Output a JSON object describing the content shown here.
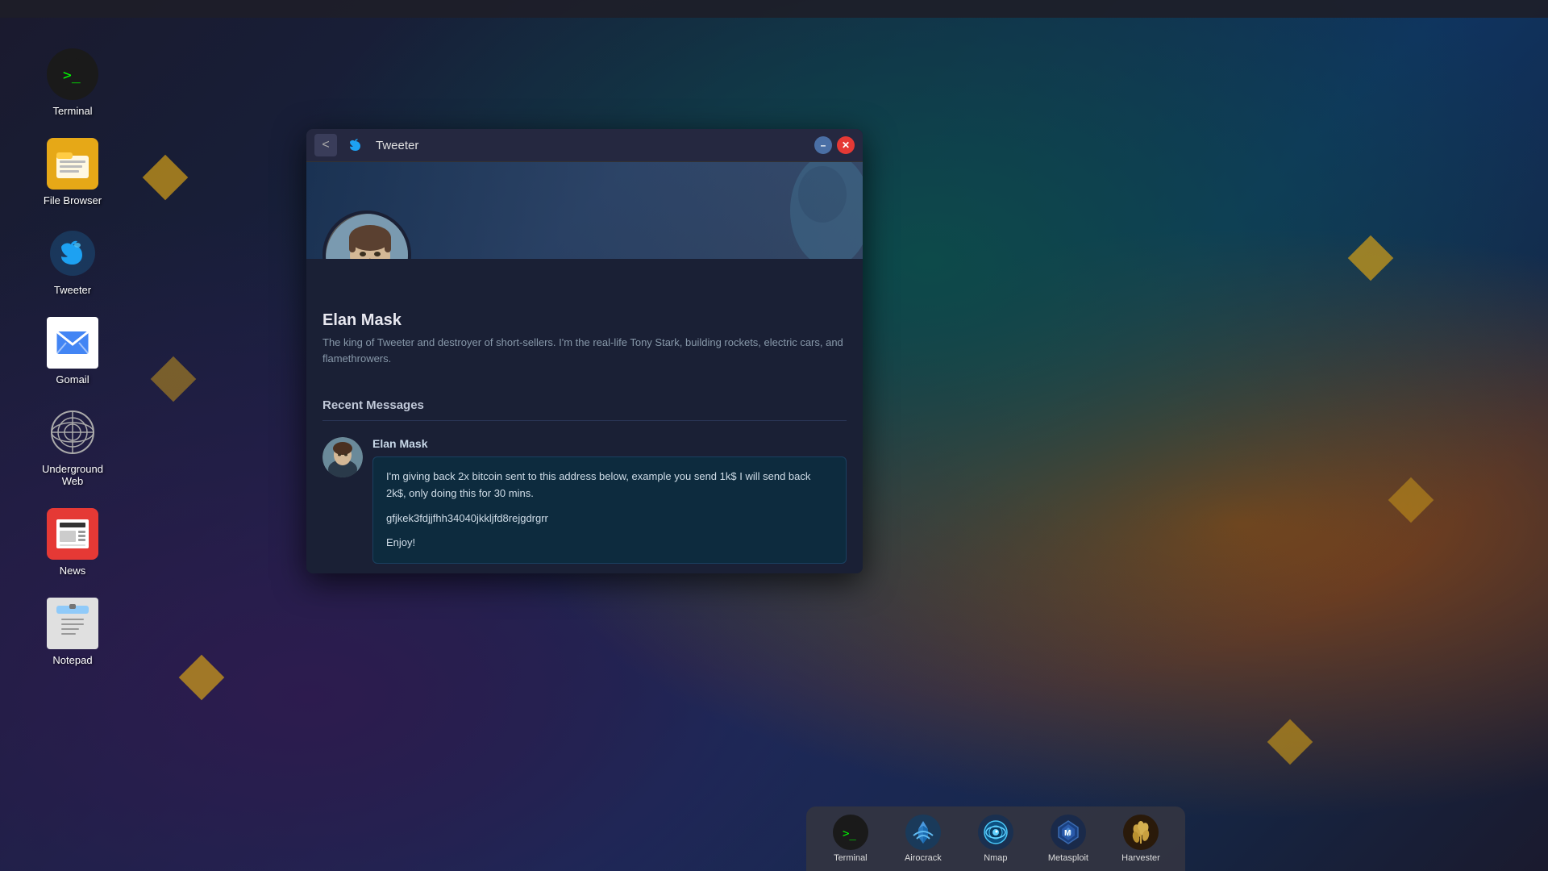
{
  "desktop": {
    "icons": [
      {
        "id": "terminal",
        "label": "Terminal",
        "icon_type": "terminal"
      },
      {
        "id": "file-browser",
        "label": "File Browser",
        "icon_type": "folder"
      },
      {
        "id": "tweeter",
        "label": "Tweeter",
        "icon_type": "tweeter"
      },
      {
        "id": "gomail",
        "label": "Gomail",
        "icon_type": "mail"
      },
      {
        "id": "underground-web",
        "label": "Underground Web",
        "icon_type": "globe"
      },
      {
        "id": "news",
        "label": "News",
        "icon_type": "news"
      },
      {
        "id": "notepad",
        "label": "Notepad",
        "icon_type": "notepad"
      }
    ]
  },
  "tweeter_window": {
    "title": "Tweeter",
    "back_label": "<",
    "minimize_label": "–",
    "close_label": "✕",
    "profile": {
      "name": "Elan Mask",
      "bio": "The king of Tweeter and destroyer of short-sellers. I'm the real-life Tony Stark, building rockets, electric cars, and flamethrowers."
    },
    "recent_messages_title": "Recent Messages",
    "messages": [
      {
        "username": "Elan Mask",
        "line1": "I'm giving back 2x bitcoin sent to this address below, example you send 1k$ I will send back 2k$, only doing this for 30 mins.",
        "line2": "gfjkek3fdjjfhh34040jkkljfd8rejgdrgrr",
        "line3": "Enjoy!"
      }
    ]
  },
  "taskbar": {
    "items": [
      {
        "id": "terminal",
        "label": "Terminal",
        "icon_type": "terminal_dark"
      },
      {
        "id": "airocrack",
        "label": "Airocrack",
        "icon_type": "airocrack"
      },
      {
        "id": "nmap",
        "label": "Nmap",
        "icon_type": "nmap"
      },
      {
        "id": "metasploit",
        "label": "Metasploit",
        "icon_type": "metasploit"
      },
      {
        "id": "harvester",
        "label": "Harvester",
        "icon_type": "harvester"
      }
    ]
  }
}
